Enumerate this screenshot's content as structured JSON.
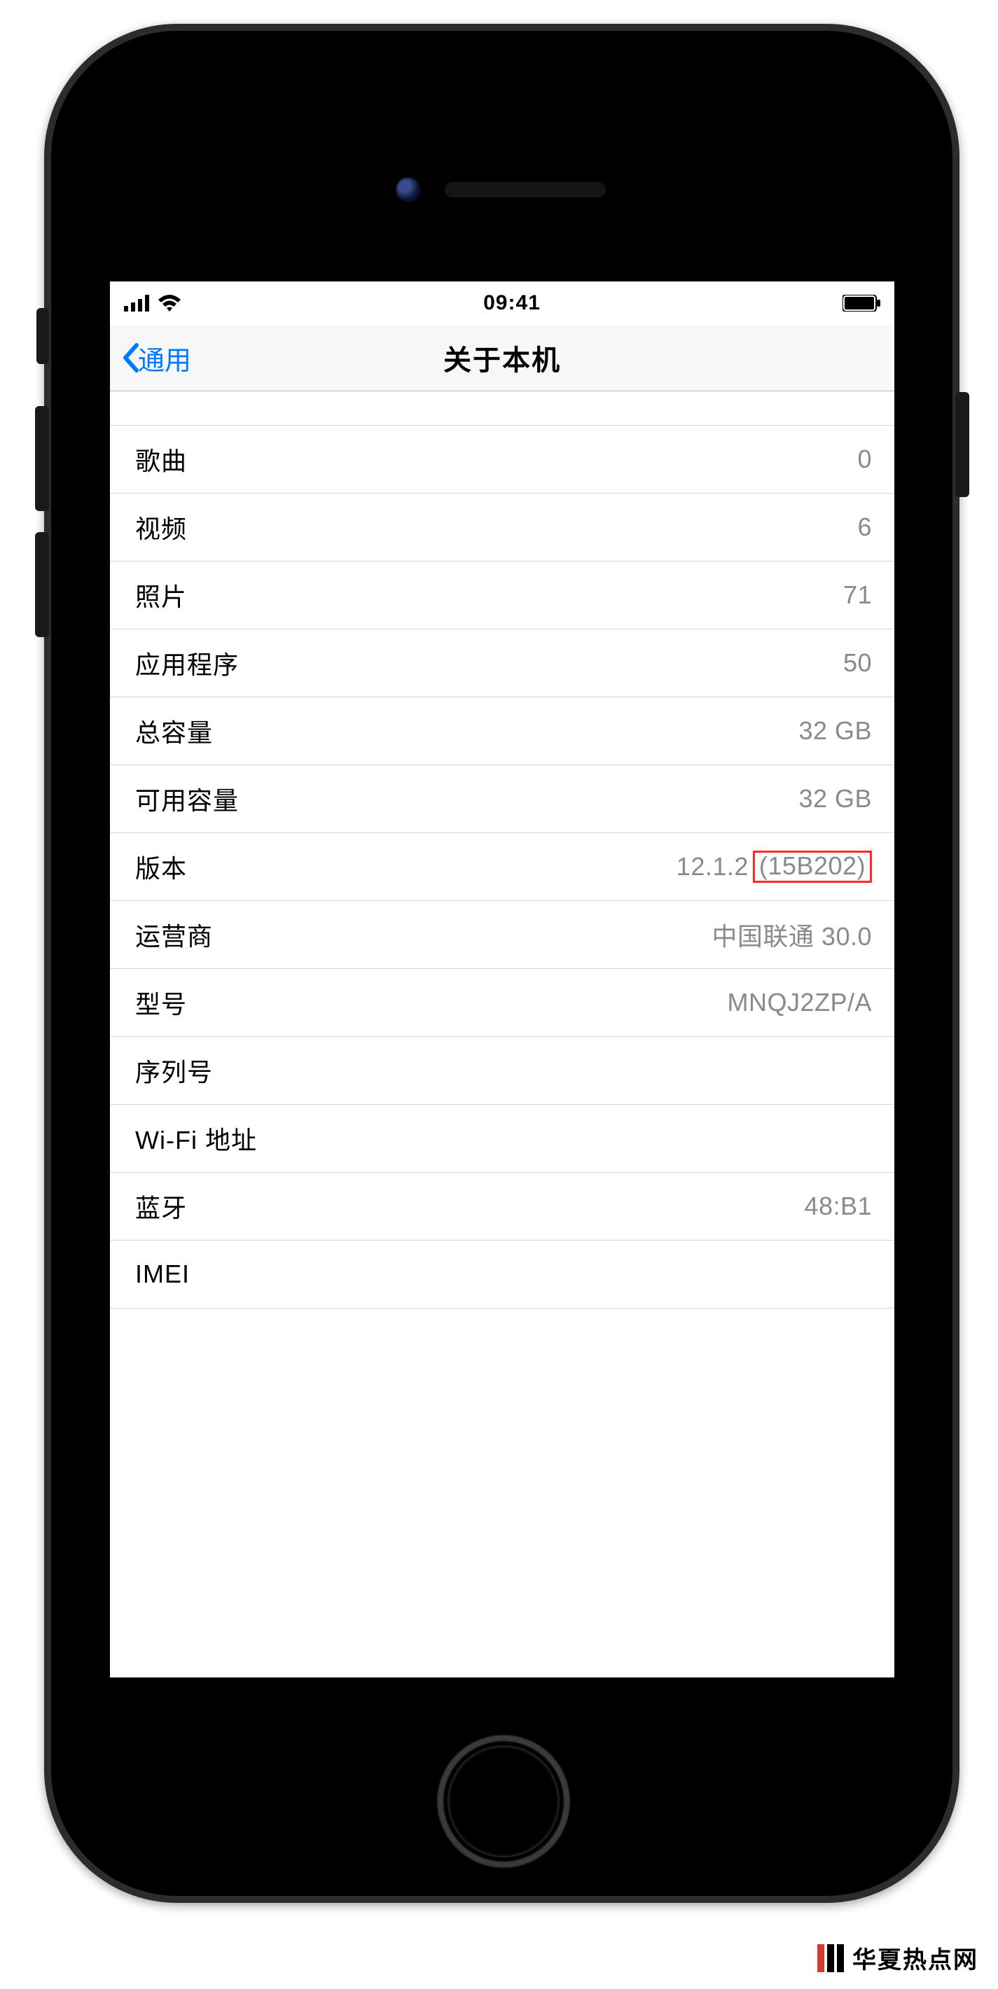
{
  "status_bar": {
    "time": "09:41"
  },
  "nav": {
    "back_label": "通用",
    "title": "关于本机"
  },
  "rows": [
    {
      "label": "歌曲",
      "value": "0"
    },
    {
      "label": "视频",
      "value": "6"
    },
    {
      "label": "照片",
      "value": "71"
    },
    {
      "label": "应用程序",
      "value": "50"
    },
    {
      "label": "总容量",
      "value": "32 GB"
    },
    {
      "label": "可用容量",
      "value": "32 GB"
    },
    {
      "label": "版本",
      "value": "12.1.2",
      "build": "(15B202)",
      "highlight_build": true
    },
    {
      "label": "运营商",
      "value": "中国联通 30.0"
    },
    {
      "label": "型号",
      "value": "MNQJ2ZP/A"
    },
    {
      "label": "序列号",
      "value": ""
    },
    {
      "label": "Wi-Fi 地址",
      "value": ""
    },
    {
      "label": "蓝牙",
      "value": "48:B1"
    },
    {
      "label": "IMEI",
      "value": ""
    }
  ],
  "watermark": {
    "text": "华夏热点网"
  }
}
